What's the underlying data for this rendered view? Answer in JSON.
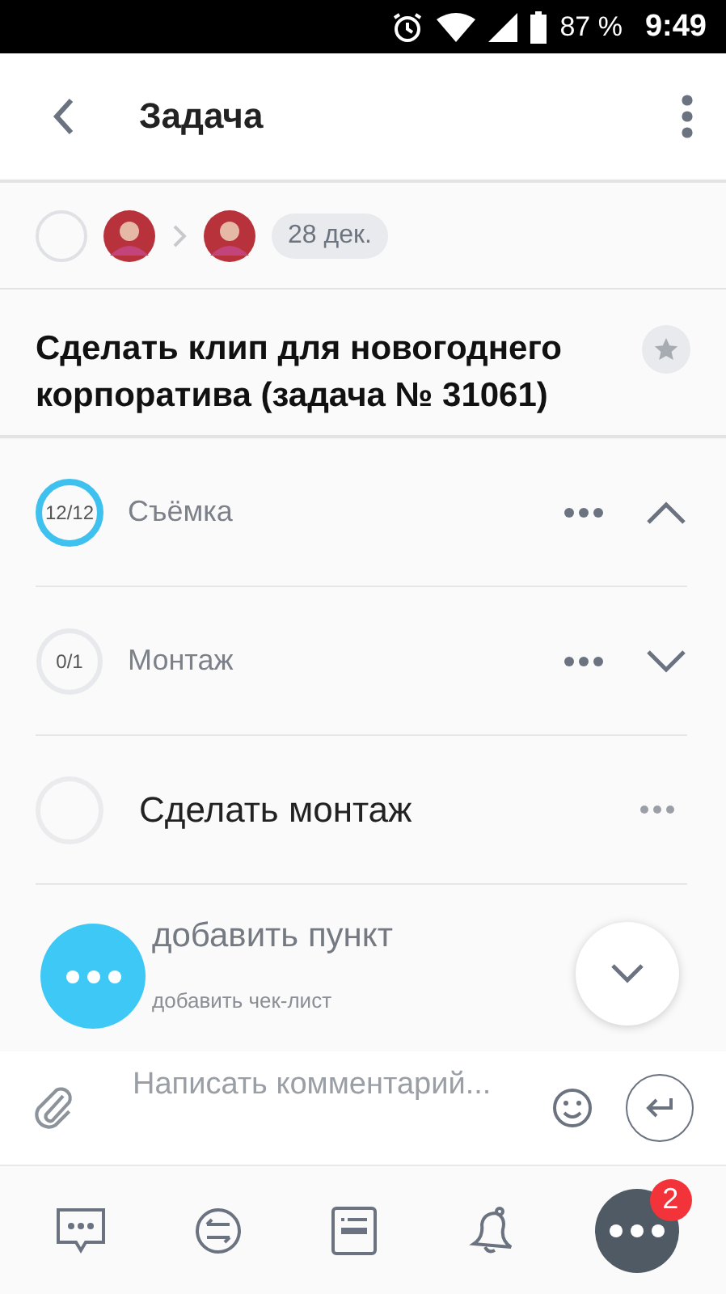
{
  "status_bar": {
    "battery": "87 %",
    "time": "9:49"
  },
  "header": {
    "title": "Задача"
  },
  "task": {
    "done": false,
    "date": "28 дек.",
    "starred": false,
    "title": "Сделать клип для новогоднего корпоратива (задача № 31061)"
  },
  "checklists": [
    {
      "progress": "12/12",
      "level": 1,
      "name": "Съёмка",
      "expanded": true
    },
    {
      "progress": "0/1",
      "level": 0,
      "name": "Монтаж",
      "expanded": false
    }
  ],
  "items": [
    {
      "text": "Сделать монтаж",
      "checked": false
    }
  ],
  "add_item": "добавить пункт",
  "add_checklist": "добавить чек-лист",
  "comment": {
    "placeholder": "Написать комментарий..."
  },
  "nav": [
    {
      "kind": "chat"
    },
    {
      "kind": "exchange"
    },
    {
      "kind": "card"
    },
    {
      "kind": "bell"
    },
    {
      "kind": "more",
      "badge": "2"
    }
  ]
}
